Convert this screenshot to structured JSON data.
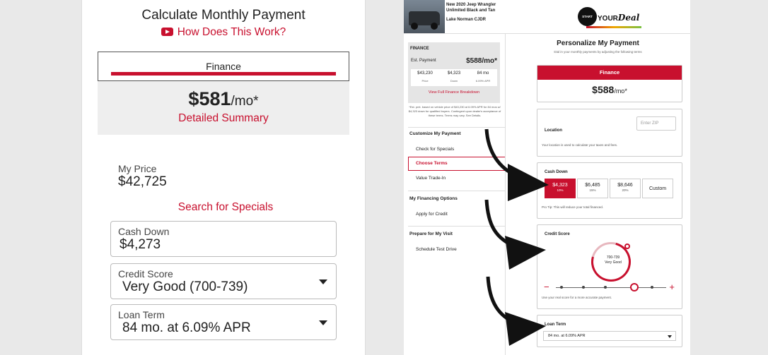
{
  "left": {
    "title": "Calculate Monthly Payment",
    "how_link": "How Does This Work?",
    "tab_label": "Finance",
    "payment_amount": "$581",
    "payment_unit": "/mo*",
    "detailed_summary": "Detailed Summary",
    "my_price_label": "My Price",
    "my_price_value": "$42,725",
    "search_specials": "Search for Specials",
    "cash_down_label": "Cash Down",
    "cash_down_value": "$4,273",
    "credit_score_label": "Credit Score",
    "credit_score_value": "Very Good (700-739)",
    "loan_term_label": "Loan Term",
    "loan_term_value": "84 mo. at 6.09% APR"
  },
  "right": {
    "vehicle_title": "New 2020 Jeep Wrangler Unlimited Black and Tan",
    "dealer": "Lake Norman CJDR",
    "logo_start": "START",
    "logo_your": "YOUR",
    "logo_deal": "Deal",
    "summary": {
      "heading": "FINANCE",
      "est_label": "Est. Payment",
      "est_value": "$588/mo*",
      "stats": [
        {
          "value": "$43,230",
          "label": "Price"
        },
        {
          "value": "$4,323",
          "label": "Down"
        },
        {
          "value": "84 mo",
          "label": "6.09% APR"
        }
      ],
      "view_link": "View Full Finance Breakdown",
      "note": "*Est. pmt. based on vehicle price of $43,230 at 6.09% APR for 84 mos w/ $4,323 down for qualified buyers. Contingent upon dealer's acceptance of these terms. Terms may vary. See Details."
    },
    "nav": {
      "customize_heading": "Customize My Payment",
      "check_specials": "Check for Specials",
      "choose_terms": "Choose Terms",
      "value_trade": "Value Trade-In",
      "financing_heading": "My Financing Options",
      "apply_credit": "Apply for Credit",
      "prepare_heading": "Prepare for My Visit",
      "test_drive": "Schedule Test Drive"
    },
    "personalize_title": "Personalize My Payment",
    "personalize_sub": "Dial in your monthly payments by adjusting the following terms",
    "finance_bar": "Finance",
    "finance_amount": "$588",
    "finance_unit": "/mo*",
    "zip_placeholder": "Enter ZIP",
    "location_label": "Location",
    "location_note": "Your location is used to calculate your taxes and fees.",
    "cash_down_label": "Cash Down",
    "cash_options": [
      {
        "value": "$4,323",
        "pct": "10%"
      },
      {
        "value": "$6,485",
        "pct": "15%"
      },
      {
        "value": "$8,646",
        "pct": "20%"
      },
      {
        "value": "Custom",
        "pct": ""
      }
    ],
    "pro_tip": "Pro Tip: This will reduce your total financed.",
    "credit_label": "Credit Score",
    "credit_range": "700-739",
    "credit_text": "Very Good",
    "credit_note": "Use your real score for a more accurate payment.",
    "loan_label": "Loan Term",
    "loan_value": "84 mo. at 6.09% APR"
  }
}
